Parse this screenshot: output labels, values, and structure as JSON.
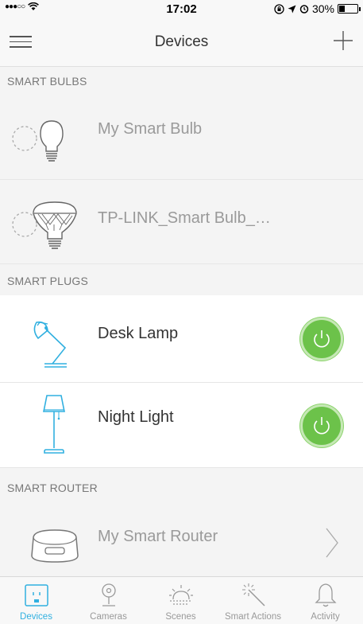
{
  "status_bar": {
    "signal": "●●●○○",
    "time": "17:02",
    "battery": "30%"
  },
  "nav": {
    "title": "Devices"
  },
  "sections": {
    "bulbs": "SMART BULBS",
    "plugs": "SMART PLUGS",
    "router": "SMART ROUTER"
  },
  "devices": {
    "bulb1": {
      "name": "My Smart Bulb",
      "state": "offline"
    },
    "bulb2": {
      "name": "TP-LINK_Smart Bulb_…",
      "state": "offline"
    },
    "plug1": {
      "name": "Desk Lamp",
      "state": "on"
    },
    "plug2": {
      "name": "Night Light",
      "state": "on"
    },
    "router": {
      "name": "My Smart Router"
    }
  },
  "tabs": [
    {
      "label": "Devices",
      "active": true
    },
    {
      "label": "Cameras"
    },
    {
      "label": "Scenes"
    },
    {
      "label": "Smart Actions"
    },
    {
      "label": "Activity"
    }
  ],
  "colors": {
    "accent": "#31b0e0",
    "power_on": "#6cc24a",
    "section_bg": "#f4f4f4"
  }
}
